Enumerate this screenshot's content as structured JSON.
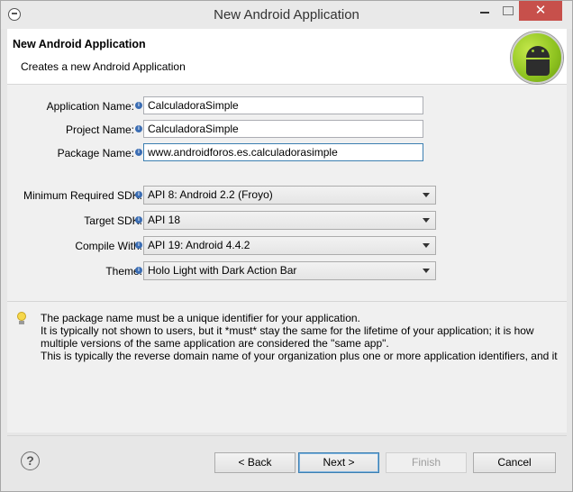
{
  "window": {
    "title": "New Android Application",
    "close_glyph": "✕"
  },
  "banner": {
    "title": "New Android Application",
    "subtitle": "Creates a new Android Application",
    "logo_icon": "android-logo"
  },
  "form": {
    "application_name": {
      "label": "Application Name:",
      "value": "CalculadoraSimple"
    },
    "project_name": {
      "label": "Project Name:",
      "value": "CalculadoraSimple"
    },
    "package_name": {
      "label": "Package Name:",
      "value": "www.androidforos.es.calculadorasimple"
    },
    "min_sdk": {
      "label": "Minimum Required SDK:",
      "value": "API 8: Android 2.2 (Froyo)"
    },
    "target_sdk": {
      "label": "Target SDK:",
      "value": "API 18"
    },
    "compile_with": {
      "label": "Compile With:",
      "value": "API 19: Android 4.4.2"
    },
    "theme": {
      "label": "Theme:",
      "value": "Holo Light with Dark Action Bar"
    }
  },
  "hint": {
    "lines": [
      "The package name must be a unique identifier for your application.",
      "It is typically not shown to users, but it *must* stay the same for the lifetime of your application; it is how",
      "multiple versions of the same application are considered the \"same app\".",
      "This is typically the reverse domain name of your organization plus one or more application identifiers, and it"
    ]
  },
  "buttons": {
    "help_glyph": "?",
    "back": "< Back",
    "next": "Next >",
    "finish": "Finish",
    "cancel": "Cancel"
  }
}
